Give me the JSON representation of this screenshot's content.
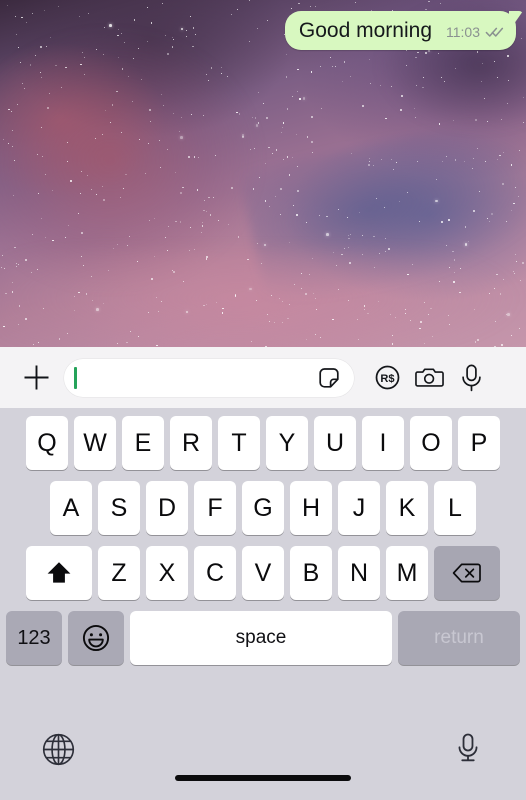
{
  "app": {
    "name": "WhatsApp Chat Keyboard",
    "wallpaper_name": "galaxy-nebula-wallpaper"
  },
  "conversation": {
    "messages": [
      {
        "text": "Good morning",
        "time": "11:03",
        "status": "delivered",
        "status_icon": "double-check-icon",
        "outgoing": true,
        "bubble_color": "#d8f8c0",
        "text_color": "#16191c",
        "time_color": "#8a9190"
      }
    ]
  },
  "input_bar": {
    "plus_icon": "plus-icon",
    "field_value": "",
    "field_placeholder": "",
    "caret_color": "#25a35a",
    "sticker_icon": "sticker-icon",
    "payment_icon": "brl-payment-icon",
    "payment_label": "R$",
    "camera_icon": "camera-icon",
    "mic_icon": "microphone-icon"
  },
  "keyboard": {
    "layout": "qwerty",
    "background": "#d3d2da",
    "key_color": "#ffffff",
    "modifier_color": "#a9a8b4",
    "row1": [
      "Q",
      "W",
      "E",
      "R",
      "T",
      "Y",
      "U",
      "I",
      "O",
      "P"
    ],
    "row2": [
      "A",
      "S",
      "D",
      "F",
      "G",
      "H",
      "J",
      "K",
      "L"
    ],
    "row3_letters": [
      "Z",
      "X",
      "C",
      "V",
      "B",
      "N",
      "M"
    ],
    "shift_icon": "shift-arrow-icon",
    "backspace_icon": "backspace-icon",
    "numbers_label": "123",
    "emoji_icon": "emoji-smiley-icon",
    "space_label": "space",
    "return_label": "return",
    "return_disabled": true
  },
  "bottom_bar": {
    "globe_icon": "globe-icon",
    "dictation_icon": "dictation-microphone-icon",
    "home_indicator": "home-indicator"
  }
}
